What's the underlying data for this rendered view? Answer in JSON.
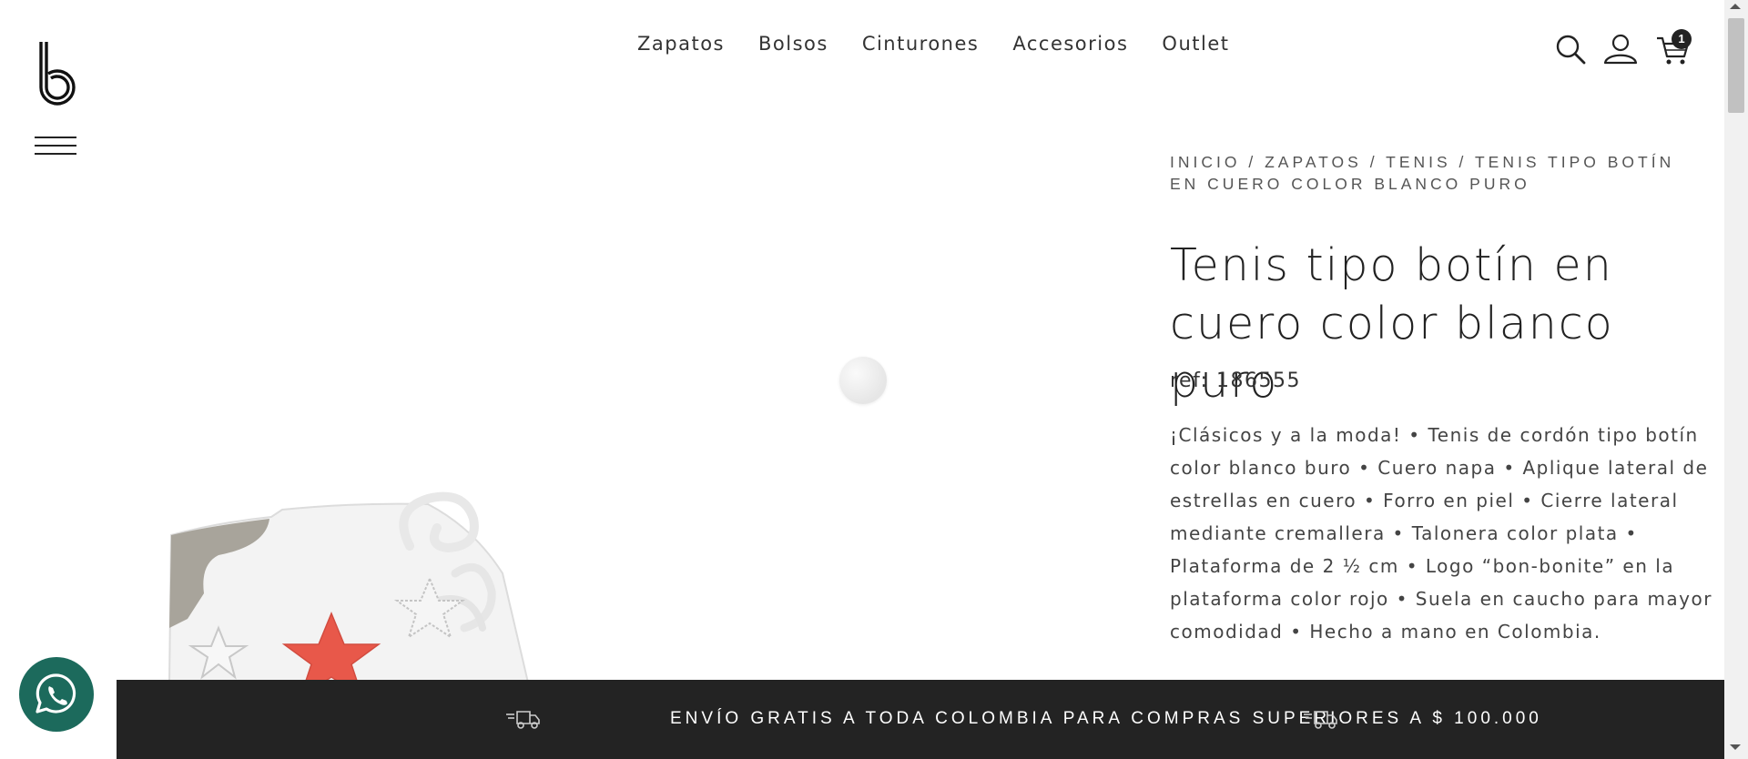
{
  "nav": {
    "items": [
      {
        "label": "Zapatos"
      },
      {
        "label": "Bolsos"
      },
      {
        "label": "Cinturones"
      },
      {
        "label": "Accesorios"
      },
      {
        "label": "Outlet"
      }
    ]
  },
  "header": {
    "logo_icon": "bon-bonite-logo",
    "menu_icon": "hamburger-icon",
    "search_icon": "search-icon",
    "account_icon": "user-icon",
    "cart_icon": "cart-icon",
    "cart_count": "1"
  },
  "breadcrumb": {
    "items": [
      "INICIO",
      "ZAPATOS",
      "TENIS",
      "TENIS TIPO BOTÍN EN CUERO COLOR BLANCO PURO"
    ],
    "separator": " / "
  },
  "product": {
    "title": "Tenis tipo botín en cuero color blanco puro",
    "ref": "ref: 186555",
    "description": "¡Clásicos y a la moda! • Tenis de cordón tipo botín color blanco buro • Cuero napa • Aplique lateral de estrellas en cuero • Forro en piel • Cierre lateral mediante cremallera • Talonera color plata • Plataforma de 2 ½ cm • Logo “bon-bonite” en la plataforma color rojo • Suela en caucho para mayor comodidad • Hecho a mano en Colombia."
  },
  "banner": {
    "text": "ENVÍO GRATIS A TODA COLOMBIA PARA COMPRAS SUPERIORES A $ 100.000",
    "icon": "delivery-truck-icon"
  },
  "whatsapp": {
    "icon": "whatsapp-icon"
  },
  "colors": {
    "banner_bg": "#232323",
    "whatsapp_bg": "#1c6a5c",
    "star_red": "#e8584a"
  }
}
